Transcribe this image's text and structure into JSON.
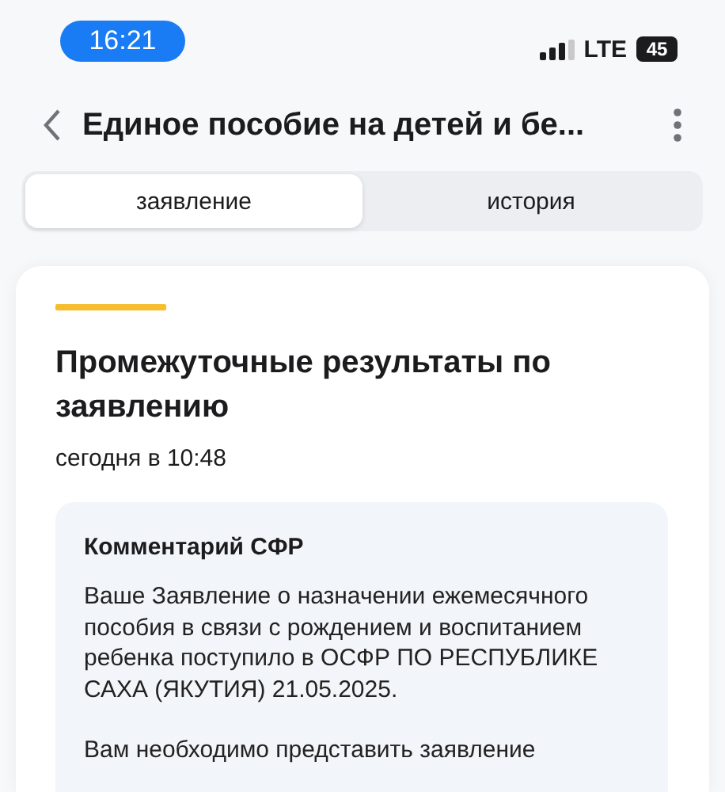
{
  "status_bar": {
    "time": "16:21",
    "network": "LTE",
    "battery": "45"
  },
  "header": {
    "title": "Единое пособие на детей и бе..."
  },
  "tabs": [
    {
      "label": "заявление",
      "selected": true
    },
    {
      "label": "история",
      "selected": false
    }
  ],
  "card": {
    "title": "Промежуточные результаты по заявлению",
    "date": "сегодня в 10:48",
    "comment": {
      "title": "Комментарий СФР",
      "paragraphs": [
        "Ваше Заявление о назначении ежемесячного пособия в связи с рождением и воспитанием ребенка поступило в ОСФР ПО РЕСПУБЛИКЕ САХА (ЯКУТИЯ) 21.05.2025.",
        "Вам необходимо представить заявление"
      ]
    }
  }
}
